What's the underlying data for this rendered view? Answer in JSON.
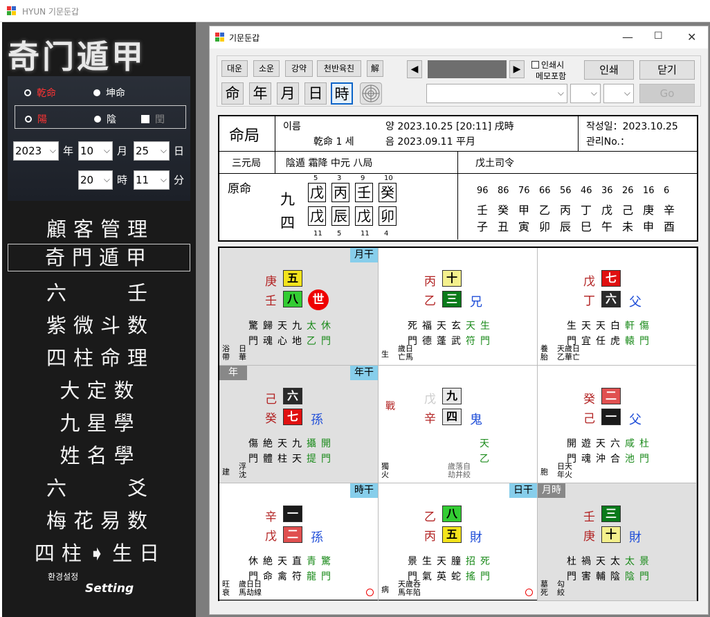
{
  "outer_title": "HYUN 기문둔갑",
  "inner_title": "기문둔갑",
  "sidebar": {
    "logo": "奇门遁甲",
    "geon": "乾命",
    "gon": "坤命",
    "yang": "陽",
    "eum": "陰",
    "yun": "閏",
    "year": "2023",
    "year_lbl": "年",
    "month": "10",
    "month_lbl": "月",
    "day": "25",
    "day_lbl": "日",
    "hour": "20",
    "hour_lbl": "時",
    "minute": "11",
    "minute_lbl": "分",
    "menu": [
      "顧客管理",
      "奇門遁甲",
      "六　　壬",
      "紫微斗数",
      "四柱命理",
      "大定数",
      "九星學",
      "姓名學",
      "六　　爻",
      "梅花易数",
      "四柱➧生日"
    ],
    "setting_k": "환경설정",
    "setting": "Setting"
  },
  "toolbar": {
    "btns": [
      "대운",
      "소운",
      "강약",
      "천반육친",
      "解"
    ],
    "big": [
      "命",
      "年",
      "月",
      "日",
      "時"
    ],
    "print_opt": "인쇄시",
    "memo_opt": "메모포함",
    "print": "인쇄",
    "close": "닫기",
    "go": "Go"
  },
  "chart": {
    "title": "命局",
    "name_lbl": "이름",
    "gender": "乾命 1 세",
    "solar": "양 2023.10.25  [20:11]  戌時",
    "lunar": "음 2023.09.11  平月",
    "date_lbl": "작성일：2023.10.25",
    "mgmt": "관리No.：",
    "sanwon": "三元局",
    "ju": "陰遁 霜降 中元 八局",
    "saryeong": "戊土司令",
    "wonmyeong": "原命",
    "g1": "九",
    "g2": "四",
    "top_nums": [
      "5",
      "3",
      "9",
      "10"
    ],
    "top": [
      "戊",
      "丙",
      "壬",
      "癸"
    ],
    "bot": [
      "戊",
      "辰",
      "戊",
      "卯"
    ],
    "bot_nums": [
      "11",
      "5",
      "11",
      "4"
    ],
    "daewoon_ages": [
      "96",
      "86",
      "76",
      "66",
      "56",
      "46",
      "36",
      "26",
      "16",
      "6"
    ],
    "daewoon_stems": [
      "壬",
      "癸",
      "甲",
      "乙",
      "丙",
      "丁",
      "戊",
      "己",
      "庚",
      "辛"
    ],
    "daewoon_branches": [
      "子",
      "丑",
      "寅",
      "卯",
      "辰",
      "巳",
      "午",
      "未",
      "申",
      "酉"
    ]
  },
  "palaces": [
    {
      "tag_r": "月干",
      "s1": "庚",
      "s2": "壬",
      "n1": "五",
      "n2": "八",
      "world": "世",
      "rel": "",
      "b1": "驚",
      "b2": "門",
      "c1": "歸",
      "c2": "魂",
      "d1": "天",
      "d2": "心",
      "e1": "九",
      "e2": "地",
      "f1": "太",
      "f2": "乙",
      "g1": "休",
      "g2": "門",
      "bl": "浴",
      "bl2": "帶",
      "bm": "日",
      "bm2": "華"
    },
    {
      "s1": "丙",
      "s2": "乙",
      "n1": "十",
      "n2": "三",
      "rel": "兄",
      "b1": "死",
      "b2": "門",
      "c1": "福",
      "c2": "德",
      "d1": "天",
      "d2": "蓬",
      "e1": "玄",
      "e2": "武",
      "f1": "天",
      "f2": "符",
      "g1": "生",
      "g2": "門",
      "bl": "生",
      "bm": "歲日",
      "bm2": "亡馬"
    },
    {
      "s1": "戊",
      "s2": "丁",
      "n1": "七",
      "n2": "六",
      "rel": "父",
      "b1": "生",
      "b2": "門",
      "c1": "天",
      "c2": "宜",
      "d1": "天",
      "d2": "任",
      "e1": "白",
      "e2": "虎",
      "f1": "軒",
      "f2": "轅",
      "g1": "傷",
      "g2": "門",
      "bl": "養",
      "bl2": "胎",
      "bm": "天歲日",
      "bm2": "乙華亡"
    },
    {
      "tag_l": "年",
      "tag_r": "年干",
      "s1": "己",
      "s2": "癸",
      "n1": "六",
      "n2": "七",
      "rel": "孫",
      "b1": "傷",
      "b2": "門",
      "c1": "絶",
      "c2": "體",
      "d1": "天",
      "d2": "柱",
      "e1": "九",
      "e2": "天",
      "f1": "攝",
      "f2": "提",
      "g1": "開",
      "g2": "門",
      "bl": "建",
      "bm": "浮",
      "bm2": "沈"
    },
    {
      "s1": "戊",
      "s2": "辛",
      "n1": "九",
      "n2": "四",
      "rel": "鬼",
      "war": "戰",
      "f1": "天",
      "f2": "乙",
      "bl": "獨",
      "bl2": "火",
      "bm": "歲落自",
      "bm2": "劫井絞"
    },
    {
      "s1": "癸",
      "s2": "己",
      "n1": "二",
      "n2": "一",
      "rel": "父",
      "b1": "開",
      "b2": "門",
      "c1": "遊",
      "c2": "魂",
      "d1": "天",
      "d2": "沖",
      "e1": "六",
      "e2": "合",
      "f1": "咸",
      "f2": "池",
      "g1": "杜",
      "g2": "門",
      "bl": "胞",
      "bm": "日天",
      "bm2": "年火"
    },
    {
      "tag_r": "時干",
      "s1": "辛",
      "s2": "戊",
      "n1": "一",
      "n2": "二",
      "rel": "孫",
      "b1": "休",
      "b2": "門",
      "c1": "絶",
      "c2": "命",
      "d1": "天",
      "d2": "禽",
      "e1": "直",
      "e2": "符",
      "f1": "青",
      "f2": "龍",
      "g1": "驚",
      "g2": "門",
      "bl": "旺",
      "bl2": "衰",
      "bm": "歲日日",
      "bm2": "馬劫線"
    },
    {
      "tag_r": "日干",
      "s1": "乙",
      "s2": "丙",
      "n1": "八",
      "n2": "五",
      "rel": "財",
      "b1": "景",
      "b2": "門",
      "c1": "生",
      "c2": "氣",
      "d1": "天",
      "d2": "英",
      "e1": "朣",
      "e2": "蛇",
      "f1": "招",
      "f2": "搖",
      "g1": "死",
      "g2": "門",
      "bl": "病",
      "bm": "天歲呑",
      "bm2": "馬年陷"
    },
    {
      "tag_l": "月時",
      "s1": "壬",
      "s2": "庚",
      "n1": "三",
      "n2": "十",
      "rel": "財",
      "b1": "杜",
      "b2": "門",
      "c1": "禍",
      "c2": "害",
      "d1": "天",
      "d2": "輔",
      "e1": "太",
      "e2": "陰",
      "f1": "太",
      "f2": "陰",
      "g1": "景",
      "g2": "門",
      "bl": "墓",
      "bl2": "死",
      "bm": "勾",
      "bm2": "絞"
    }
  ],
  "colors": {
    "num": {
      "一": "#1a1a1a",
      "二": "#e05050",
      "三": "#0a7a1a",
      "四": "#e8e8e8",
      "五": "#f4e41c",
      "六": "#2a2a2a",
      "七": "#e01010",
      "八": "#33cc33",
      "九": "#e8e8e8",
      "十": "#f4f08c"
    }
  }
}
